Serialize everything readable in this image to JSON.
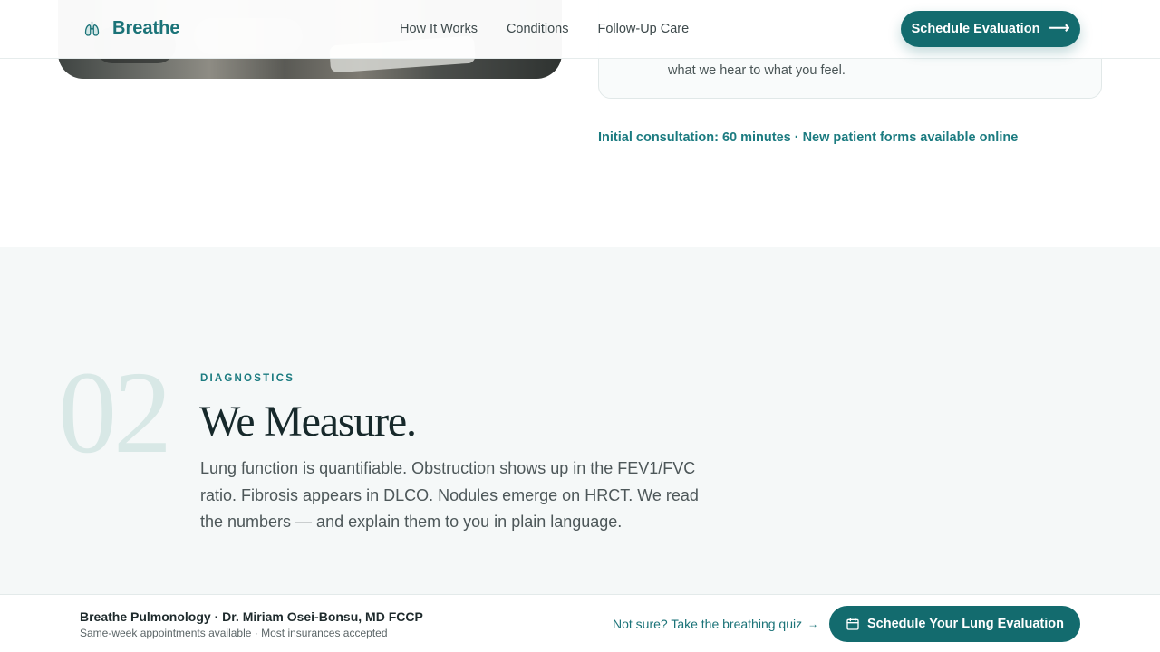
{
  "header": {
    "brand": "Breathe",
    "nav": [
      "How It Works",
      "Conditions",
      "Follow-Up Care"
    ],
    "cta": "Schedule Evaluation"
  },
  "intro": {
    "quote_fragment": "what we hear to what you feel.",
    "consult_note": "Initial consultation: 60 minutes · New patient forms available online"
  },
  "section": {
    "number": "02",
    "eyebrow": "DIAGNOSTICS",
    "headline": "We Measure.",
    "body": "Lung function is quantifiable. Obstruction shows up in the FEV1/FVC ratio. Fibrosis appears in DLCO. Nodules emerge on HRCT. We read the numbers — and explain them to you in plain language."
  },
  "bottom_bar": {
    "practice": "Breathe Pulmonology · Dr. Miriam Osei-Bonsu, MD FCCP",
    "subline": "Same-week appointments available · Most insurances accepted",
    "quiz_link": "Not sure? Take the breathing quiz",
    "cta": "Schedule Your Lung Evaluation"
  },
  "icons": {
    "brand": "lungs-icon",
    "header_cta": "arrow-right-icon",
    "quiz": "arrow-right-icon",
    "bottom_cta": "calendar-icon"
  },
  "colors": {
    "accent": "#136b6e",
    "accent_text": "#1b7b80",
    "section_bg": "#f5f8f8",
    "number_tint": "#d8e8e6"
  }
}
